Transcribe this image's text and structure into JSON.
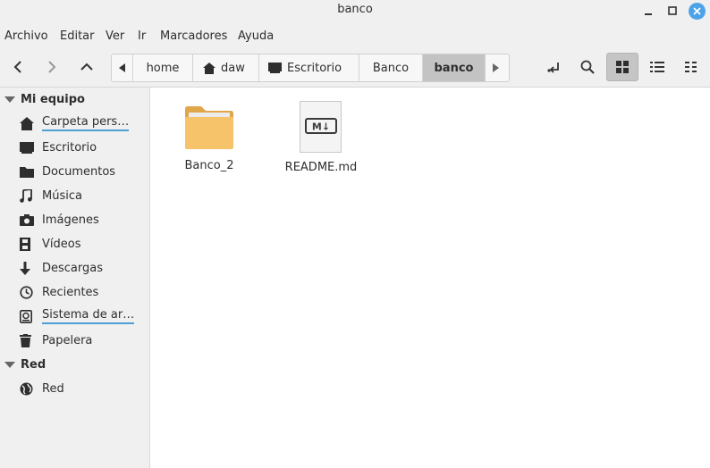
{
  "window": {
    "title": "banco"
  },
  "menu": [
    "Archivo",
    "Editar",
    "Ver",
    "Ir",
    "Marcadores",
    "Ayuda"
  ],
  "pathbar": [
    "home",
    "daw",
    "Escritorio",
    "Banco",
    "banco"
  ],
  "sidebar": {
    "sections": [
      {
        "label": "Mi equipo",
        "items": [
          {
            "label": "Carpeta pers…",
            "icon": "home-icon"
          },
          {
            "label": "Escritorio",
            "icon": "desktop-icon"
          },
          {
            "label": "Documentos",
            "icon": "documents-icon"
          },
          {
            "label": "Música",
            "icon": "music-icon"
          },
          {
            "label": "Imágenes",
            "icon": "camera-icon"
          },
          {
            "label": "Vídeos",
            "icon": "film-icon"
          },
          {
            "label": "Descargas",
            "icon": "download-icon"
          },
          {
            "label": "Recientes",
            "icon": "clock-icon"
          },
          {
            "label": "Sistema de ar…",
            "icon": "drive-icon"
          },
          {
            "label": "Papelera",
            "icon": "trash-icon"
          }
        ]
      },
      {
        "label": "Red",
        "items": [
          {
            "label": "Red",
            "icon": "globe-icon"
          }
        ]
      }
    ]
  },
  "files": [
    {
      "name": "Banco_2",
      "type": "folder",
      "icon": "folder-icon"
    },
    {
      "name": "README.md",
      "type": "markdown",
      "icon": "markdown-file-icon",
      "icon_text": "M↓"
    }
  ],
  "colors": {
    "folder": "#f6c36a",
    "accent": "#4da3e8",
    "selected_segment": "#c3c3c3"
  }
}
